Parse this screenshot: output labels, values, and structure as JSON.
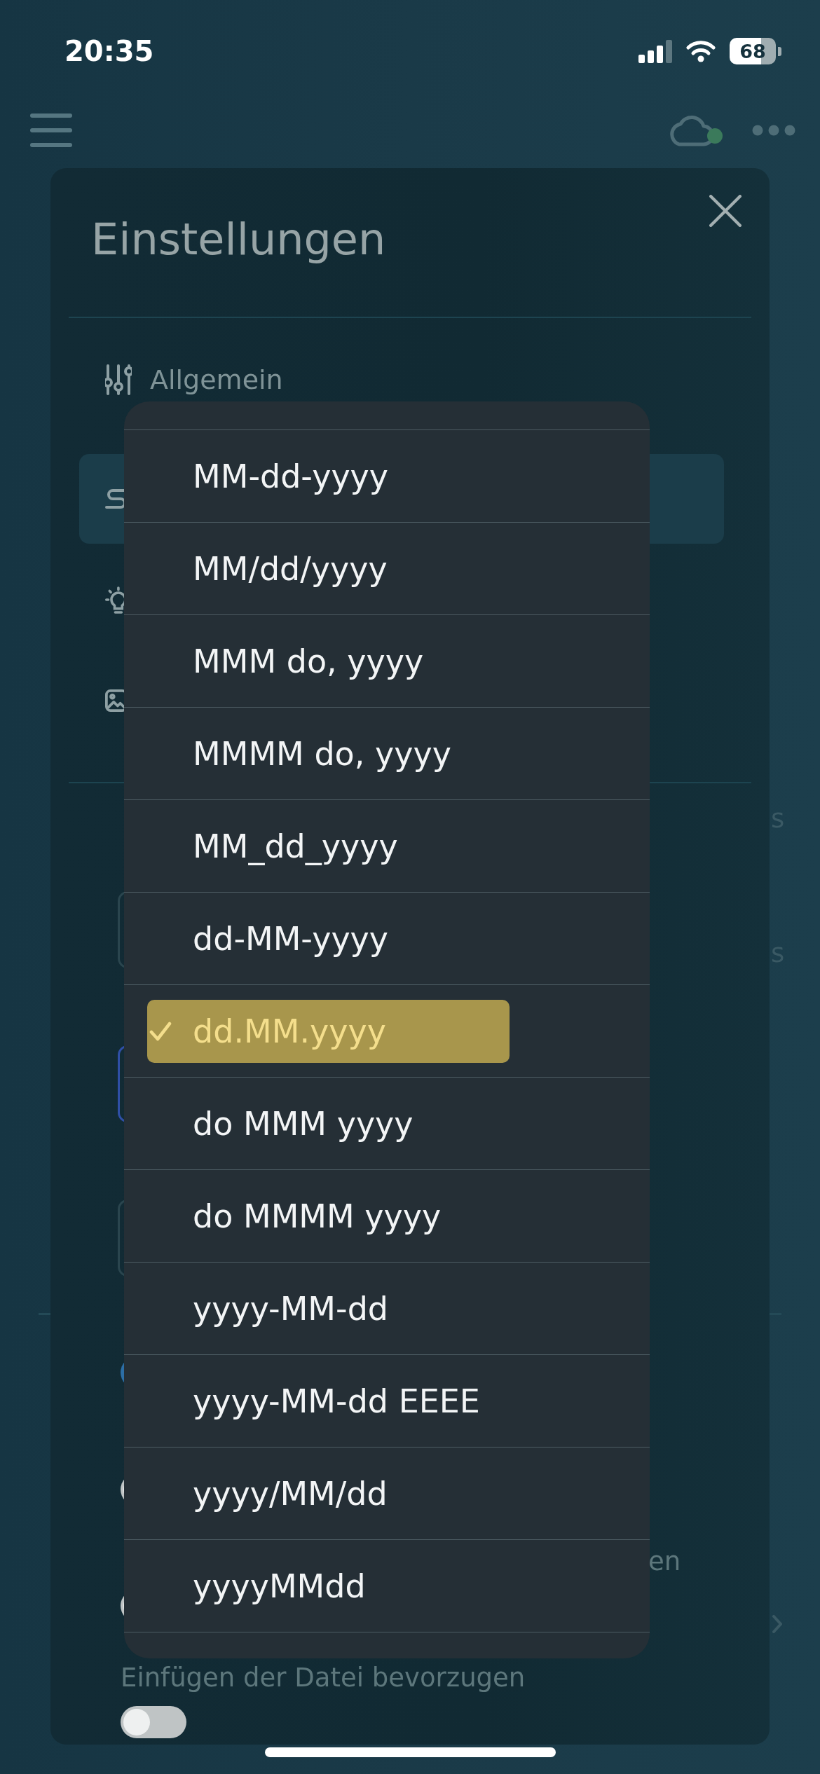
{
  "status_bar": {
    "time": "20:35",
    "battery": "68"
  },
  "page_fragments": [
    {
      "text": "s"
    },
    {
      "text": "s"
    }
  ],
  "settings": {
    "title": "Einstellungen",
    "menu": [
      {
        "label": "Allgemein",
        "selected": false
      },
      {
        "selected": true
      },
      {
        "selected": false
      },
      {
        "selected": false
      }
    ],
    "form": [
      {
        "kind": "field",
        "focused": false
      },
      {
        "kind": "field",
        "focused": true
      },
      {
        "kind": "field",
        "focused": false
      },
      {
        "kind": "toggle",
        "on": true
      },
      {
        "kind": "toggle",
        "on": false
      },
      {
        "kind": "tail",
        "text": "en"
      },
      {
        "kind": "toggle",
        "on": false
      },
      {
        "kind": "label",
        "text": "Einfügen der Datei bevorzugen"
      },
      {
        "kind": "toggle",
        "on": false
      }
    ]
  },
  "date_format_menu": {
    "options": [
      {
        "label": "MM-dd-yyyy",
        "selected": false
      },
      {
        "label": "MM/dd/yyyy",
        "selected": false
      },
      {
        "label": "MMM do, yyyy",
        "selected": false
      },
      {
        "label": "MMMM do, yyyy",
        "selected": false
      },
      {
        "label": "MM_dd_yyyy",
        "selected": false
      },
      {
        "label": "dd-MM-yyyy",
        "selected": false
      },
      {
        "label": "dd.MM.yyyy",
        "selected": true
      },
      {
        "label": "do MMM yyyy",
        "selected": false
      },
      {
        "label": "do MMMM yyyy",
        "selected": false
      },
      {
        "label": "yyyy-MM-dd",
        "selected": false
      },
      {
        "label": "yyyy-MM-dd EEEE",
        "selected": false
      },
      {
        "label": "yyyy/MM/dd",
        "selected": false
      },
      {
        "label": "yyyyMMdd",
        "selected": false
      }
    ]
  }
}
